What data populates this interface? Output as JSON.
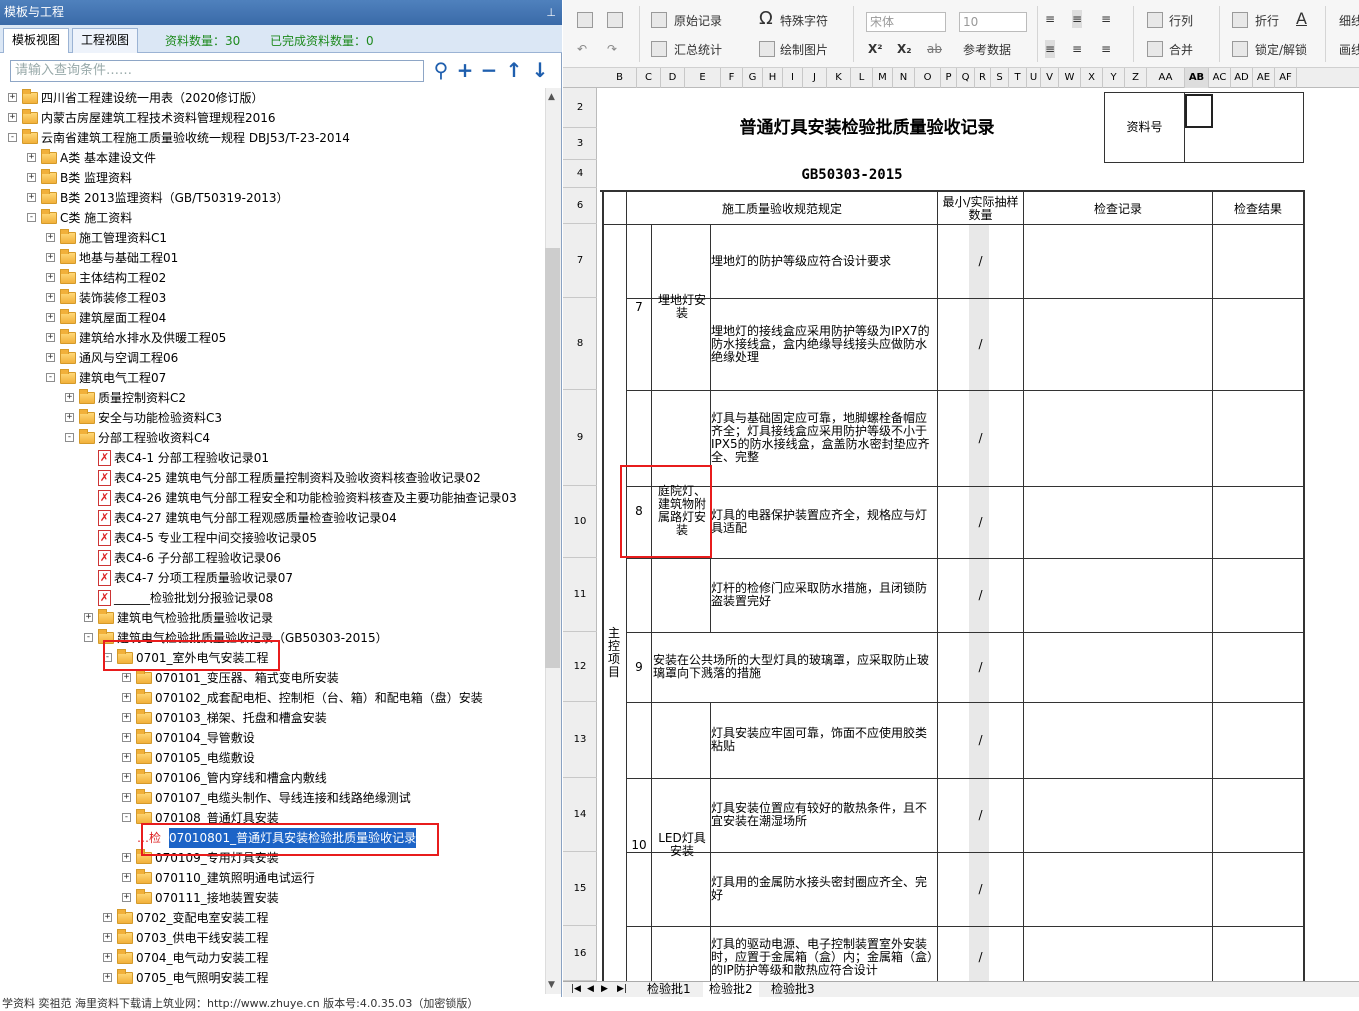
{
  "left_panel": {
    "title": "模板与工程",
    "pin": "₋",
    "tabs": [
      "模板视图",
      "工程视图"
    ],
    "stat_total_label": "资料数量：30",
    "stat_done_label": "已完成资料数量：0",
    "search_placeholder": "请输入查询条件……",
    "tree": [
      {
        "label": "四川省工程建设统一用表（2020修订版）",
        "lvl": 0,
        "type": "folder",
        "exp": "+"
      },
      {
        "label": "内蒙古房屋建筑工程技术资料管理规程2016",
        "lvl": 0,
        "type": "folder",
        "exp": "+"
      },
      {
        "label": "云南省建筑工程施工质量验收统一规程 DBJ53/T-23-2014",
        "lvl": 0,
        "type": "folder",
        "exp": "-"
      },
      {
        "label": "A类 基本建设文件",
        "lvl": 1,
        "type": "folder",
        "exp": "+"
      },
      {
        "label": "B类 监理资料",
        "lvl": 1,
        "type": "folder",
        "exp": "+"
      },
      {
        "label": "B类 2013监理资料（GB/T50319-2013）",
        "lvl": 1,
        "type": "folder",
        "exp": "+"
      },
      {
        "label": "C类 施工资料",
        "lvl": 1,
        "type": "folder",
        "exp": "-"
      },
      {
        "label": "施工管理资料C1",
        "lvl": 2,
        "type": "folder",
        "exp": "+"
      },
      {
        "label": "地基与基础工程01",
        "lvl": 2,
        "type": "folder",
        "exp": "+"
      },
      {
        "label": "主体结构工程02",
        "lvl": 2,
        "type": "folder",
        "exp": "+"
      },
      {
        "label": "装饰装修工程03",
        "lvl": 2,
        "type": "folder",
        "exp": "+"
      },
      {
        "label": "建筑屋面工程04",
        "lvl": 2,
        "type": "folder",
        "exp": "+"
      },
      {
        "label": "建筑给水排水及供暖工程05",
        "lvl": 2,
        "type": "folder",
        "exp": "+"
      },
      {
        "label": "通风与空调工程06",
        "lvl": 2,
        "type": "folder",
        "exp": "+"
      },
      {
        "label": "建筑电气工程07",
        "lvl": 2,
        "type": "folder",
        "exp": "-"
      },
      {
        "label": "质量控制资料C2",
        "lvl": 3,
        "type": "folder",
        "exp": "+"
      },
      {
        "label": "安全与功能检验资料C3",
        "lvl": 3,
        "type": "folder",
        "exp": "+"
      },
      {
        "label": "分部工程验收资料C4",
        "lvl": 3,
        "type": "folder",
        "exp": "-"
      },
      {
        "label": "表C4-1 分部工程验收记录01",
        "lvl": 4,
        "type": "doc",
        "exp": ""
      },
      {
        "label": "表C4-25 建筑电气分部工程质量控制资料及验收资料核查验收记录02",
        "lvl": 4,
        "type": "doc",
        "exp": ""
      },
      {
        "label": "表C4-26 建筑电气分部工程安全和功能检验资料核查及主要功能抽查记录03",
        "lvl": 4,
        "type": "doc",
        "exp": ""
      },
      {
        "label": "表C4-27 建筑电气分部工程观感质量检查验收记录04",
        "lvl": 4,
        "type": "doc",
        "exp": ""
      },
      {
        "label": "表C4-5 专业工程中间交接验收记录05",
        "lvl": 4,
        "type": "doc",
        "exp": ""
      },
      {
        "label": "表C4-6 子分部工程验收记录06",
        "lvl": 4,
        "type": "doc",
        "exp": ""
      },
      {
        "label": "表C4-7 分项工程质量验收记录07",
        "lvl": 4,
        "type": "doc",
        "exp": ""
      },
      {
        "label": "______检验批划分报验记录08",
        "lvl": 4,
        "type": "doc",
        "exp": ""
      },
      {
        "label": "建筑电气检验批质量验收记录",
        "lvl": 4,
        "type": "folder",
        "exp": "+"
      },
      {
        "label": "建筑电气检验批质量验收记录（GB50303-2015）",
        "lvl": 4,
        "type": "folder",
        "exp": "-"
      },
      {
        "label": "0701_室外电气安装工程",
        "lvl": 5,
        "type": "folder",
        "exp": "-"
      },
      {
        "label": "070101_变压器、箱式变电所安装",
        "lvl": 6,
        "type": "folder",
        "exp": "+"
      },
      {
        "label": "070102_成套配电柜、控制柜（台、箱）和配电箱（盘）安装",
        "lvl": 6,
        "type": "folder",
        "exp": "+"
      },
      {
        "label": "070103_梯架、托盘和槽盒安装",
        "lvl": 6,
        "type": "folder",
        "exp": "+"
      },
      {
        "label": "070104_导管敷设",
        "lvl": 6,
        "type": "folder",
        "exp": "+"
      },
      {
        "label": "070105_电缆敷设",
        "lvl": 6,
        "type": "folder",
        "exp": "+"
      },
      {
        "label": "070106_管内穿线和槽盒内敷线",
        "lvl": 6,
        "type": "folder",
        "exp": "+"
      },
      {
        "label": "070107_电缆头制作、导线连接和线路绝缘测试",
        "lvl": 6,
        "type": "folder",
        "exp": "+"
      },
      {
        "label": "070108_普通灯具安装",
        "lvl": 6,
        "type": "folder",
        "exp": "-"
      },
      {
        "label": "07010801_普通灯具安装检验批质量验收记录",
        "lvl": 7,
        "type": "check",
        "exp": "",
        "selected": true,
        "prefix": "检"
      },
      {
        "label": "070109_专用灯具安装",
        "lvl": 6,
        "type": "folder",
        "exp": "+"
      },
      {
        "label": "070110_建筑照明通电试运行",
        "lvl": 6,
        "type": "folder",
        "exp": "+"
      },
      {
        "label": "070111_接地装置安装",
        "lvl": 6,
        "type": "folder",
        "exp": "+"
      },
      {
        "label": "0702_变配电室安装工程",
        "lvl": 5,
        "type": "folder",
        "exp": "+"
      },
      {
        "label": "0703_供电干线安装工程",
        "lvl": 5,
        "type": "folder",
        "exp": "+"
      },
      {
        "label": "0704_电气动力安装工程",
        "lvl": 5,
        "type": "folder",
        "exp": "+"
      },
      {
        "label": "0705_电气照明安装工程",
        "lvl": 5,
        "type": "folder",
        "exp": "+"
      }
    ]
  },
  "ribbon": {
    "orig_record": "原始记录",
    "special_char": "特殊字符",
    "summary": "汇总统计",
    "insert_image": "绘制图片",
    "font_name": "宋体",
    "font_size": "10",
    "ref_data": "参考数据",
    "row_col": "行列",
    "merge": "合并",
    "fold": "折行",
    "lock": "锁定/解锁",
    "thin": "细线",
    "frame": "画线",
    "sup": "X²",
    "sub": "X₂",
    "strike": "ab"
  },
  "columns": [
    "B",
    "C",
    "D",
    "E",
    "F",
    "G",
    "H",
    "I",
    "J",
    "K",
    "L",
    "M",
    "N",
    "O",
    "P",
    "Q",
    "R",
    "S",
    "T",
    "U",
    "V",
    "W",
    "X",
    "Y",
    "Z",
    "AA",
    "AB",
    "AC",
    "AD",
    "AE",
    "AF"
  ],
  "rows": [
    "2",
    "3",
    "4",
    "6",
    "7",
    "8",
    "9",
    "10",
    "11",
    "12",
    "13",
    "14",
    "15",
    "16"
  ],
  "form": {
    "title": "普通灯具安装检验批质量验收记录",
    "standard": "GB50303-2015",
    "doc_no_label": "资料号",
    "hdr_spec": "施工质量验收规范规定",
    "hdr_min": "最小/实际抽样数量",
    "hdr_check": "检查记录",
    "hdr_result": "检查结果",
    "main_item": "主控项目",
    "items": [
      {
        "no": "7",
        "name": "埋地灯安装"
      },
      {
        "no": "8",
        "name": "庭院灯、建筑物附属路灯安装"
      },
      {
        "no": "9",
        "name": "安装在公共场所的大型灯具的玻璃罩，应采取防止玻璃罩向下溅落的措施"
      },
      {
        "no": "10",
        "name": "LED灯具安装"
      }
    ],
    "specs": [
      "埋地灯的防护等级应符合设计要求",
      "埋地灯的接线盒应采用防护等级为IPX7的防水接线盒，盒内绝缘导线接头应做防水绝缘处理",
      "灯具与基础固定应可靠，地脚螺栓备帽应齐全；灯具接线盒应采用防护等级不小于IPX5的防水接线盒，盒盖防水密封垫应齐全、完整",
      "灯具的电器保护装置应齐全，规格应与灯具适配",
      "灯杆的检修门应采取防水措施，且闭锁防盗装置完好",
      "",
      "灯具安装应牢固可靠，饰面不应使用胶类粘贴",
      "灯具安装位置应有较好的散热条件，且不宜安装在潮湿场所",
      "灯具用的金属防水接头密封圈应齐全、完好",
      "灯具的驱动电源、电子控制装置室外安装时，应置于金属箱（盒）内；金属箱（盒）的IP防护等级和散热应符合设计"
    ],
    "slash": "/"
  },
  "sheet_tabs": [
    "检验批1",
    "检验批2",
    "检验批3"
  ],
  "status_text": "学资料    奕祖范    海里资料下载请上筑业网：http://www.zhuye.cn    版本号:4.0.35.03（加密锁版）"
}
